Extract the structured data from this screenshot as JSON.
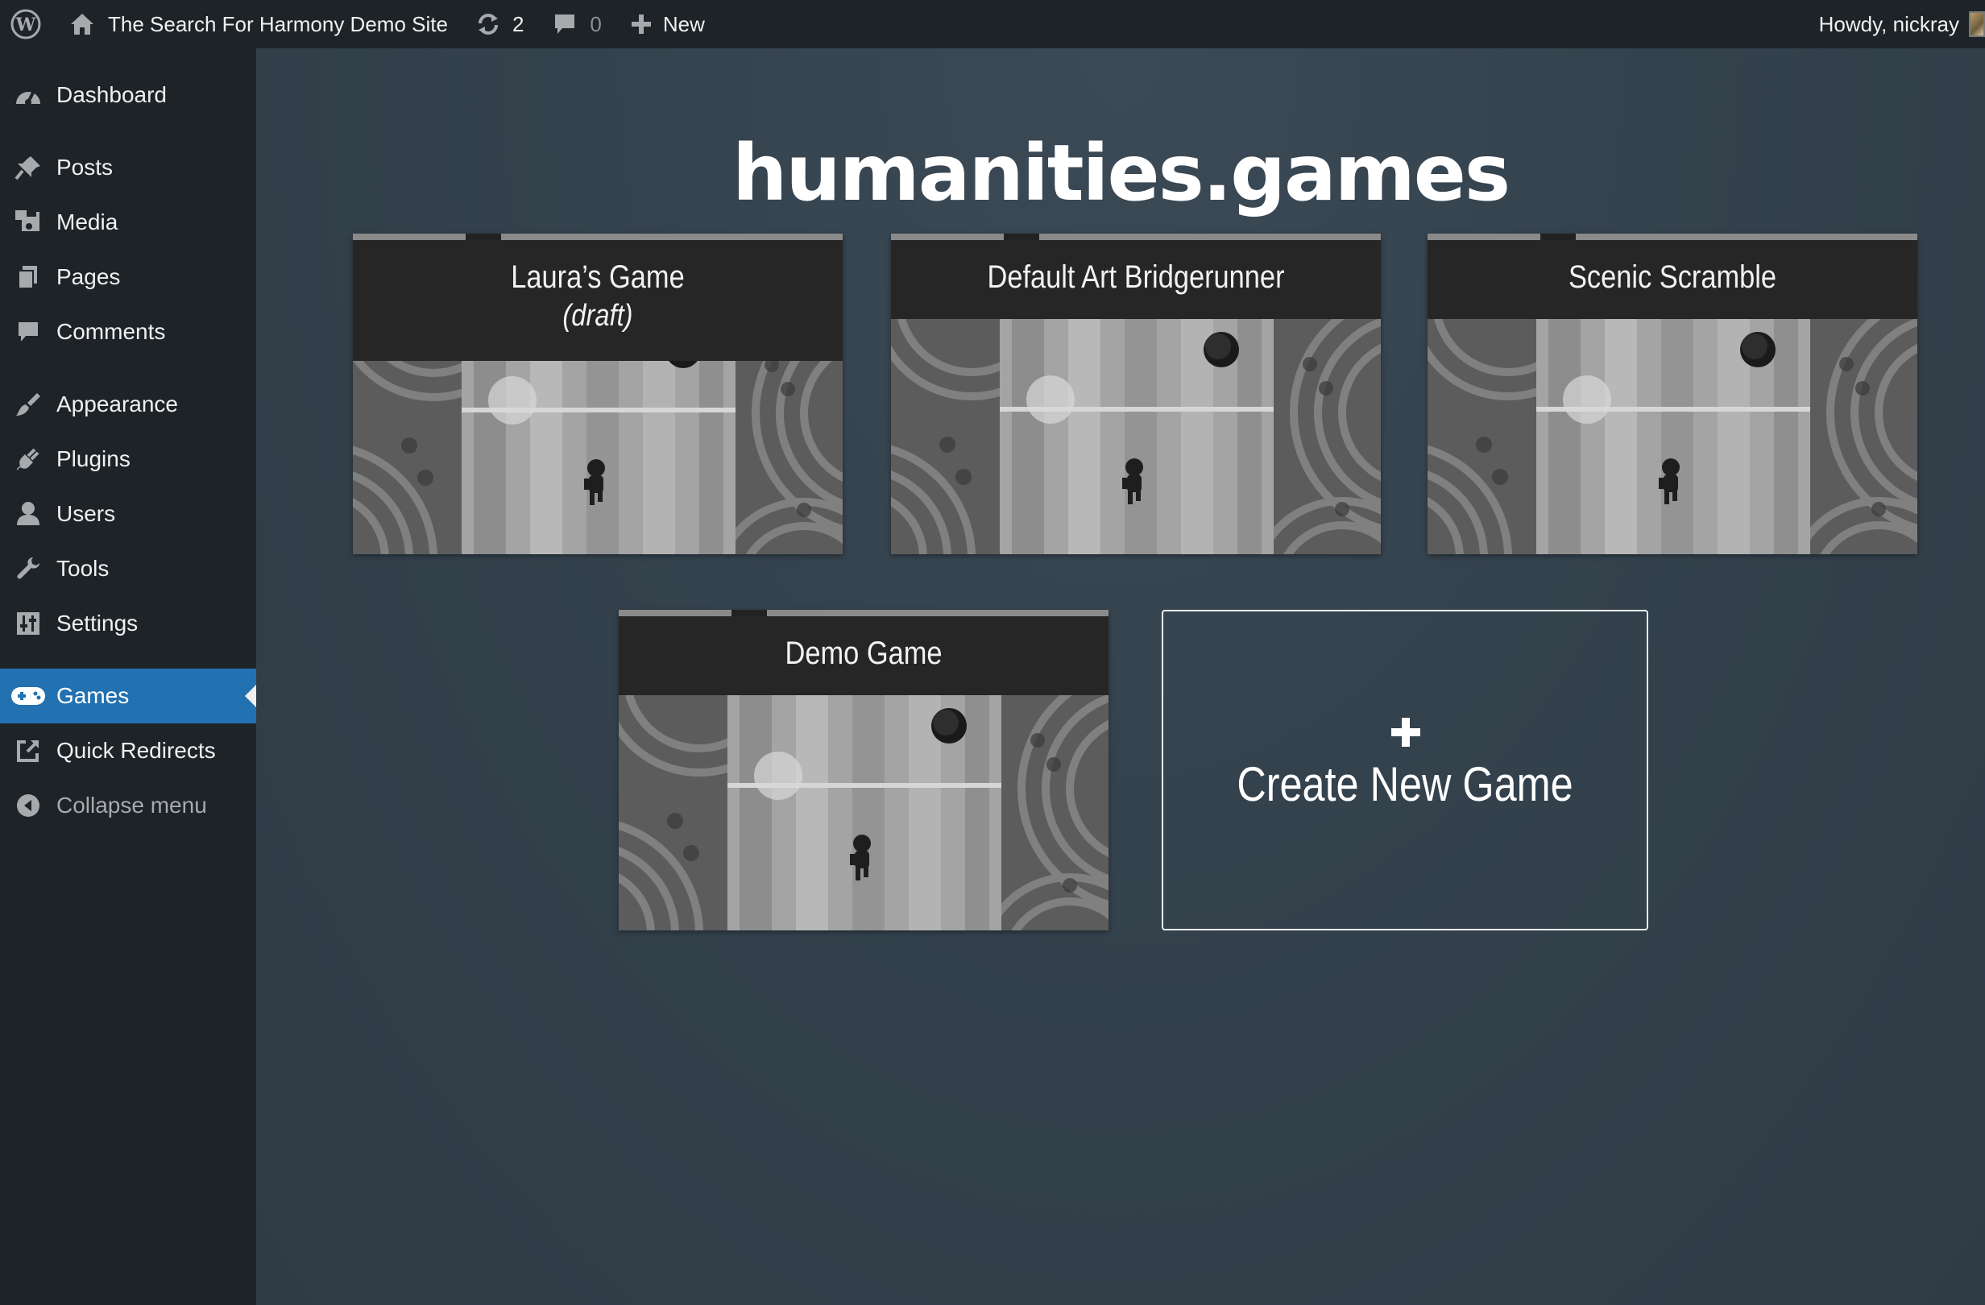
{
  "admin_bar": {
    "site_name": "The Search For Harmony Demo Site",
    "updates_count": "2",
    "comments_count": "0",
    "new_label": "New",
    "howdy": "Howdy, nickray"
  },
  "sidebar": {
    "items": [
      {
        "label": "Dashboard",
        "icon": "dashboard-icon"
      },
      {
        "label": "Posts",
        "icon": "pin-icon"
      },
      {
        "label": "Media",
        "icon": "media-icon"
      },
      {
        "label": "Pages",
        "icon": "pages-icon"
      },
      {
        "label": "Comments",
        "icon": "comment-icon"
      },
      {
        "label": "Appearance",
        "icon": "brush-icon"
      },
      {
        "label": "Plugins",
        "icon": "plug-icon"
      },
      {
        "label": "Users",
        "icon": "user-icon"
      },
      {
        "label": "Tools",
        "icon": "wrench-icon"
      },
      {
        "label": "Settings",
        "icon": "sliders-icon"
      },
      {
        "label": "Games",
        "icon": "gamepad-icon",
        "current": true
      },
      {
        "label": "Quick Redirects",
        "icon": "external-link-icon"
      },
      {
        "label": "Collapse menu",
        "icon": "collapse-icon"
      }
    ]
  },
  "main": {
    "title": "humanities.games",
    "games": [
      {
        "title": "Laura’s Game",
        "status": "(draft)"
      },
      {
        "title": "Default Art Bridgerunner",
        "status": ""
      },
      {
        "title": "Scenic Scramble",
        "status": ""
      },
      {
        "title": "Demo Game",
        "status": ""
      }
    ],
    "create_label": "Create New Game"
  },
  "colors": {
    "admin_bar_bg": "#1d2327",
    "sidebar_bg": "#1d2327",
    "current_menu_bg": "#2271b1",
    "content_bg": "#34424d",
    "card_header_bg": "#262626"
  }
}
